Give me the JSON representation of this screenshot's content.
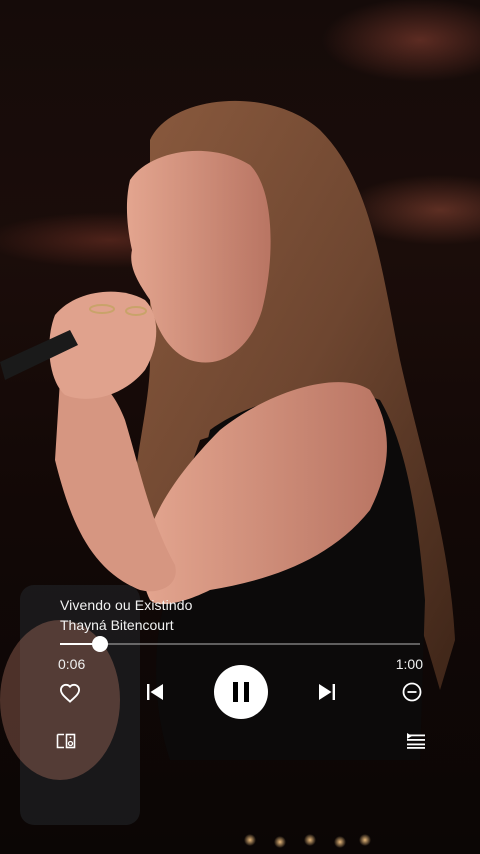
{
  "player": {
    "song_title": "Vivendo ou Existindo",
    "artist": "Thayná Bitencourt",
    "elapsed": "0:06",
    "duration": "1:00",
    "progress": 0.11,
    "is_playing": true
  },
  "icons": {
    "like": "heart-icon",
    "previous": "skip-previous-icon",
    "play_pause": "pause-icon",
    "next": "skip-next-icon",
    "remove": "minus-circle-icon",
    "devices": "connect-device-icon",
    "queue": "queue-icon"
  },
  "colors": {
    "controls": "#ffffff",
    "background": "#0d0806"
  }
}
